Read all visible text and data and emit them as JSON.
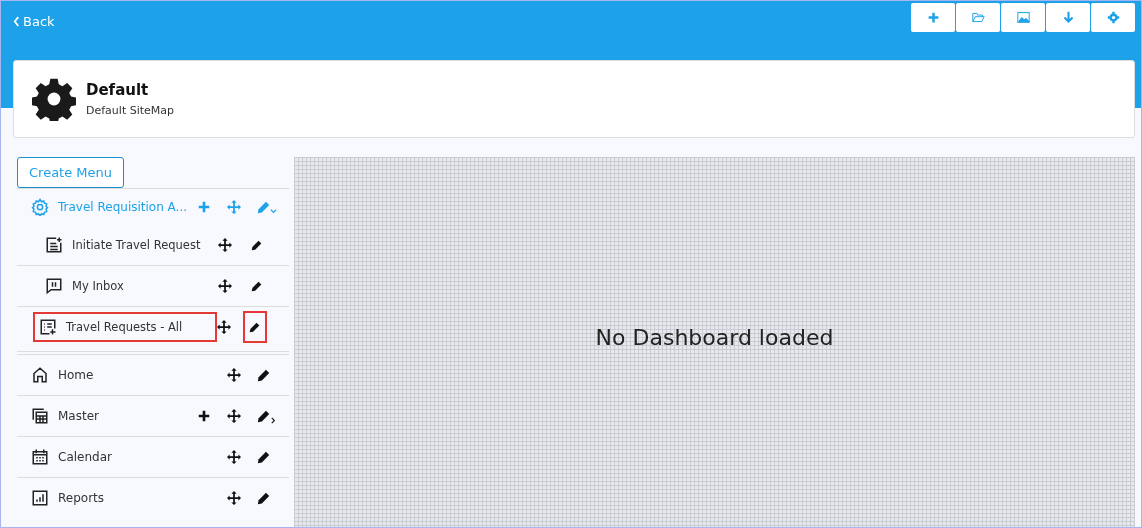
{
  "back": {
    "label": "Back"
  },
  "sitemap": {
    "title": "Default",
    "subtitle": "Default SiteMap"
  },
  "create_button": {
    "label": "Create Menu"
  },
  "menu": [
    {
      "label": "Travel Requisition A...",
      "kind": "group",
      "expanded": true,
      "children": [
        {
          "label": "Initiate Travel Request",
          "selected": false
        },
        {
          "label": "My Inbox",
          "selected": false
        },
        {
          "label": "Travel Requests - All",
          "selected": true
        }
      ]
    },
    {
      "label": "Home",
      "kind": "link"
    },
    {
      "label": "Master",
      "kind": "group",
      "expanded": false
    },
    {
      "label": "Calendar",
      "kind": "link"
    },
    {
      "label": "Reports",
      "kind": "link"
    }
  ],
  "canvas": {
    "message": "No Dashboard loaded"
  }
}
